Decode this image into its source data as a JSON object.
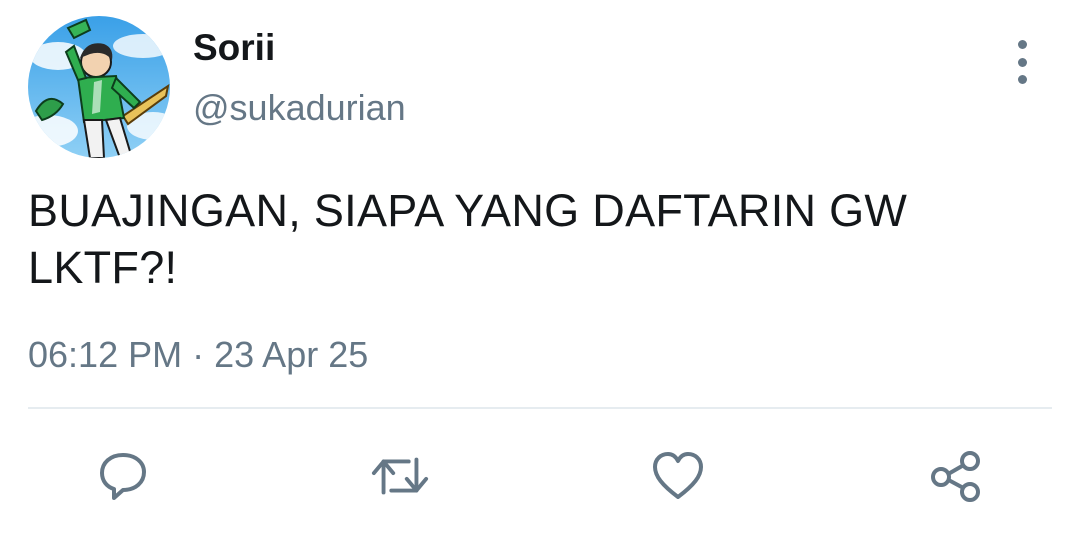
{
  "author": {
    "display_name": "Sorii",
    "handle": "@sukadurian"
  },
  "tweet": {
    "text_line1": "BUAJINGAN, SIAPA YANG DAFTARIN GW",
    "text_line2": "LKTF?!",
    "time": "06:12 PM",
    "separator": "·",
    "date": "23 Apr 25"
  },
  "icons": {
    "more": "more-vertical-icon",
    "reply": "reply-icon",
    "retweet": "retweet-icon",
    "like": "heart-icon",
    "share": "share-icon"
  },
  "colors": {
    "text": "#14171a",
    "secondary": "#657786",
    "divider": "#e6ecf0"
  }
}
